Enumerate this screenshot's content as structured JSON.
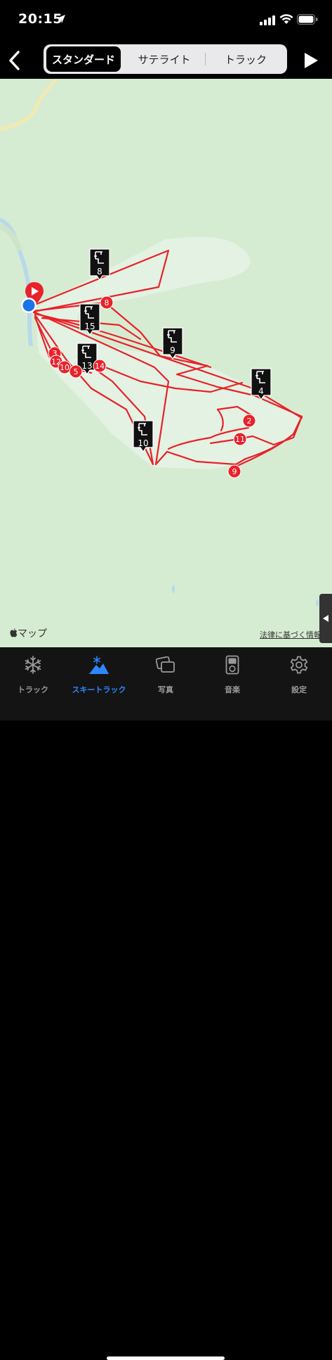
{
  "status": {
    "time": "20:15"
  },
  "nav": {
    "tabs": [
      {
        "label": "スタンダード",
        "selected": true
      },
      {
        "label": "サテライト",
        "selected": false
      },
      {
        "label": "トラック",
        "selected": false
      }
    ]
  },
  "map": {
    "attribution": "マップ",
    "legal": "法律に基づく情報",
    "colors": {
      "land": "#d6ecd2",
      "area": "#e4f2e3",
      "track": "#e8222a",
      "road": "#f3e8b0"
    },
    "lift_markers": [
      "8",
      "15",
      "13",
      "9",
      "4",
      "10"
    ],
    "waypoints": [
      "8",
      "3",
      "12",
      "10",
      "5",
      "14",
      "2",
      "11",
      "9"
    ]
  },
  "tabbar": {
    "items": [
      {
        "label": "トラック",
        "icon": "snowflake-icon",
        "active": false
      },
      {
        "label": "スキートラック",
        "icon": "mountain-snowflake-icon",
        "active": true
      },
      {
        "label": "写真",
        "icon": "photos-icon",
        "active": false
      },
      {
        "label": "音楽",
        "icon": "music-player-icon",
        "active": false
      },
      {
        "label": "設定",
        "icon": "gear-icon",
        "active": false
      }
    ]
  }
}
